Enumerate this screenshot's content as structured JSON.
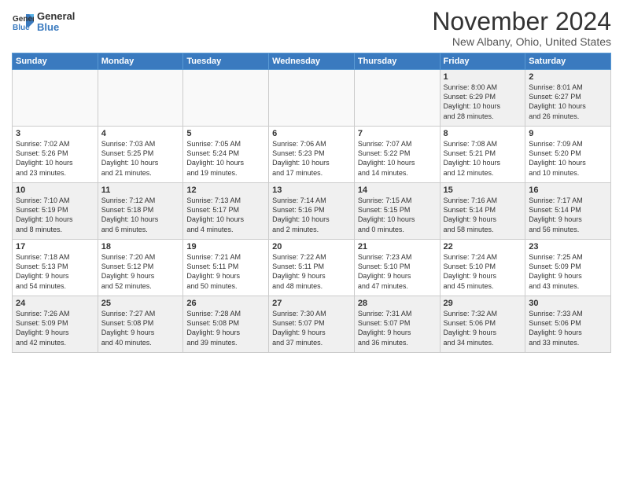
{
  "header": {
    "logo_line1": "General",
    "logo_line2": "Blue",
    "month": "November 2024",
    "location": "New Albany, Ohio, United States"
  },
  "weekdays": [
    "Sunday",
    "Monday",
    "Tuesday",
    "Wednesday",
    "Thursday",
    "Friday",
    "Saturday"
  ],
  "weeks": [
    [
      {
        "day": "",
        "info": ""
      },
      {
        "day": "",
        "info": ""
      },
      {
        "day": "",
        "info": ""
      },
      {
        "day": "",
        "info": ""
      },
      {
        "day": "",
        "info": ""
      },
      {
        "day": "1",
        "info": "Sunrise: 8:00 AM\nSunset: 6:29 PM\nDaylight: 10 hours\nand 28 minutes."
      },
      {
        "day": "2",
        "info": "Sunrise: 8:01 AM\nSunset: 6:27 PM\nDaylight: 10 hours\nand 26 minutes."
      }
    ],
    [
      {
        "day": "3",
        "info": "Sunrise: 7:02 AM\nSunset: 5:26 PM\nDaylight: 10 hours\nand 23 minutes."
      },
      {
        "day": "4",
        "info": "Sunrise: 7:03 AM\nSunset: 5:25 PM\nDaylight: 10 hours\nand 21 minutes."
      },
      {
        "day": "5",
        "info": "Sunrise: 7:05 AM\nSunset: 5:24 PM\nDaylight: 10 hours\nand 19 minutes."
      },
      {
        "day": "6",
        "info": "Sunrise: 7:06 AM\nSunset: 5:23 PM\nDaylight: 10 hours\nand 17 minutes."
      },
      {
        "day": "7",
        "info": "Sunrise: 7:07 AM\nSunset: 5:22 PM\nDaylight: 10 hours\nand 14 minutes."
      },
      {
        "day": "8",
        "info": "Sunrise: 7:08 AM\nSunset: 5:21 PM\nDaylight: 10 hours\nand 12 minutes."
      },
      {
        "day": "9",
        "info": "Sunrise: 7:09 AM\nSunset: 5:20 PM\nDaylight: 10 hours\nand 10 minutes."
      }
    ],
    [
      {
        "day": "10",
        "info": "Sunrise: 7:10 AM\nSunset: 5:19 PM\nDaylight: 10 hours\nand 8 minutes."
      },
      {
        "day": "11",
        "info": "Sunrise: 7:12 AM\nSunset: 5:18 PM\nDaylight: 10 hours\nand 6 minutes."
      },
      {
        "day": "12",
        "info": "Sunrise: 7:13 AM\nSunset: 5:17 PM\nDaylight: 10 hours\nand 4 minutes."
      },
      {
        "day": "13",
        "info": "Sunrise: 7:14 AM\nSunset: 5:16 PM\nDaylight: 10 hours\nand 2 minutes."
      },
      {
        "day": "14",
        "info": "Sunrise: 7:15 AM\nSunset: 5:15 PM\nDaylight: 10 hours\nand 0 minutes."
      },
      {
        "day": "15",
        "info": "Sunrise: 7:16 AM\nSunset: 5:14 PM\nDaylight: 9 hours\nand 58 minutes."
      },
      {
        "day": "16",
        "info": "Sunrise: 7:17 AM\nSunset: 5:14 PM\nDaylight: 9 hours\nand 56 minutes."
      }
    ],
    [
      {
        "day": "17",
        "info": "Sunrise: 7:18 AM\nSunset: 5:13 PM\nDaylight: 9 hours\nand 54 minutes."
      },
      {
        "day": "18",
        "info": "Sunrise: 7:20 AM\nSunset: 5:12 PM\nDaylight: 9 hours\nand 52 minutes."
      },
      {
        "day": "19",
        "info": "Sunrise: 7:21 AM\nSunset: 5:11 PM\nDaylight: 9 hours\nand 50 minutes."
      },
      {
        "day": "20",
        "info": "Sunrise: 7:22 AM\nSunset: 5:11 PM\nDaylight: 9 hours\nand 48 minutes."
      },
      {
        "day": "21",
        "info": "Sunrise: 7:23 AM\nSunset: 5:10 PM\nDaylight: 9 hours\nand 47 minutes."
      },
      {
        "day": "22",
        "info": "Sunrise: 7:24 AM\nSunset: 5:10 PM\nDaylight: 9 hours\nand 45 minutes."
      },
      {
        "day": "23",
        "info": "Sunrise: 7:25 AM\nSunset: 5:09 PM\nDaylight: 9 hours\nand 43 minutes."
      }
    ],
    [
      {
        "day": "24",
        "info": "Sunrise: 7:26 AM\nSunset: 5:09 PM\nDaylight: 9 hours\nand 42 minutes."
      },
      {
        "day": "25",
        "info": "Sunrise: 7:27 AM\nSunset: 5:08 PM\nDaylight: 9 hours\nand 40 minutes."
      },
      {
        "day": "26",
        "info": "Sunrise: 7:28 AM\nSunset: 5:08 PM\nDaylight: 9 hours\nand 39 minutes."
      },
      {
        "day": "27",
        "info": "Sunrise: 7:30 AM\nSunset: 5:07 PM\nDaylight: 9 hours\nand 37 minutes."
      },
      {
        "day": "28",
        "info": "Sunrise: 7:31 AM\nSunset: 5:07 PM\nDaylight: 9 hours\nand 36 minutes."
      },
      {
        "day": "29",
        "info": "Sunrise: 7:32 AM\nSunset: 5:06 PM\nDaylight: 9 hours\nand 34 minutes."
      },
      {
        "day": "30",
        "info": "Sunrise: 7:33 AM\nSunset: 5:06 PM\nDaylight: 9 hours\nand 33 minutes."
      }
    ]
  ]
}
